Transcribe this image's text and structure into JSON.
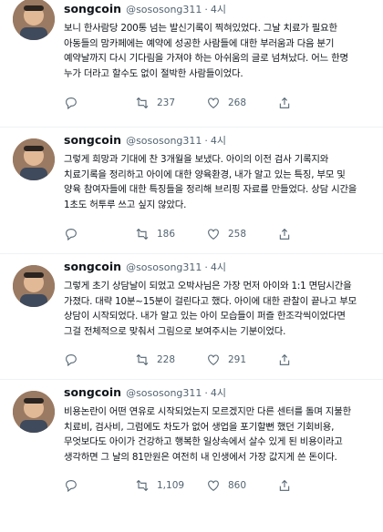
{
  "tweets": [
    {
      "name": "songcoin",
      "handle": "@sososong311",
      "sep": "·",
      "time": "4시",
      "lines": [
        "보니 한사람당 200통 넘는 발신기록이 찍혀있었다. 그날 치료가 필요한",
        "아동들의 맘카페에는 예약에 성공한 사람들에 대한 부러움과 다음 분기",
        "예약날까지 다시 기다림을 가져야 하는 아쉬움의 글로 넘쳐났다. 어느 한명",
        "누가 더라고 할수도 없이 절박한 사람들이었다."
      ],
      "retweets": "71",
      "likes": "237",
      "shares_count": "268"
    },
    {
      "name": "songcoin",
      "handle": "@sososong311",
      "sep": "·",
      "time": "4시",
      "lines": [
        "그렇게 희망과 기대에 찬 3개월을 보냈다. 아이의 이전 검사 기록지와",
        "치료기록을 정리하고 아이에 대한 양육환경, 내가 알고 있는 특징, 부모 및",
        "양육 참여자들에 대한 특징들을 정리해 브리핑 자료를 만들었다. 상담 시간을",
        "1초도 허투루 쓰고 싶지 않았다."
      ],
      "retweets": "",
      "likes": "186",
      "shares_count": "258"
    },
    {
      "name": "songcoin",
      "handle": "@sososong311",
      "sep": "·",
      "time": "4시",
      "lines": [
        "그렇게 초기 상담날이 되었고 오박사님은 가장 먼저 아이와 1:1 면담시간을",
        "가졌다. 대략 10분~15분이 걸린다고 했다. 아이에 대한 관찰이 끝나고 부모",
        "상담이 시작되었다. 내가 알고 있는 아이 모습들이 퍼즐 한조각씩이었다면",
        "그걸 전체적으로 맞춰서 그림으로 보여주시는 기분이었다."
      ],
      "retweets": "",
      "likes": "228",
      "shares_count": "291"
    },
    {
      "name": "songcoin",
      "handle": "@sososong311",
      "sep": "·",
      "time": "4시",
      "lines": [
        "비용논란이 어떤 연유로 시작되었는지 모르겠지만 다른 센터를 돌며 지불한",
        "치료비, 검사비, 그럼에도 차도가 없어 생업을 포기할뻔 했던 기회비용,",
        "무엇보다도 아이가 건강하고 행복한 일상속에서 살수 있게 된 비용이라고",
        "생각하면 그 날의 81만원은 여전히 내 인생에서 가장 값지게 쓴 돈이다."
      ],
      "retweets": "",
      "likes": "1,109",
      "shares_count": "860"
    }
  ],
  "icons": {
    "reply": "reply-icon",
    "retweet": "retweet-icon",
    "like": "heart-icon",
    "share": "share-icon"
  }
}
